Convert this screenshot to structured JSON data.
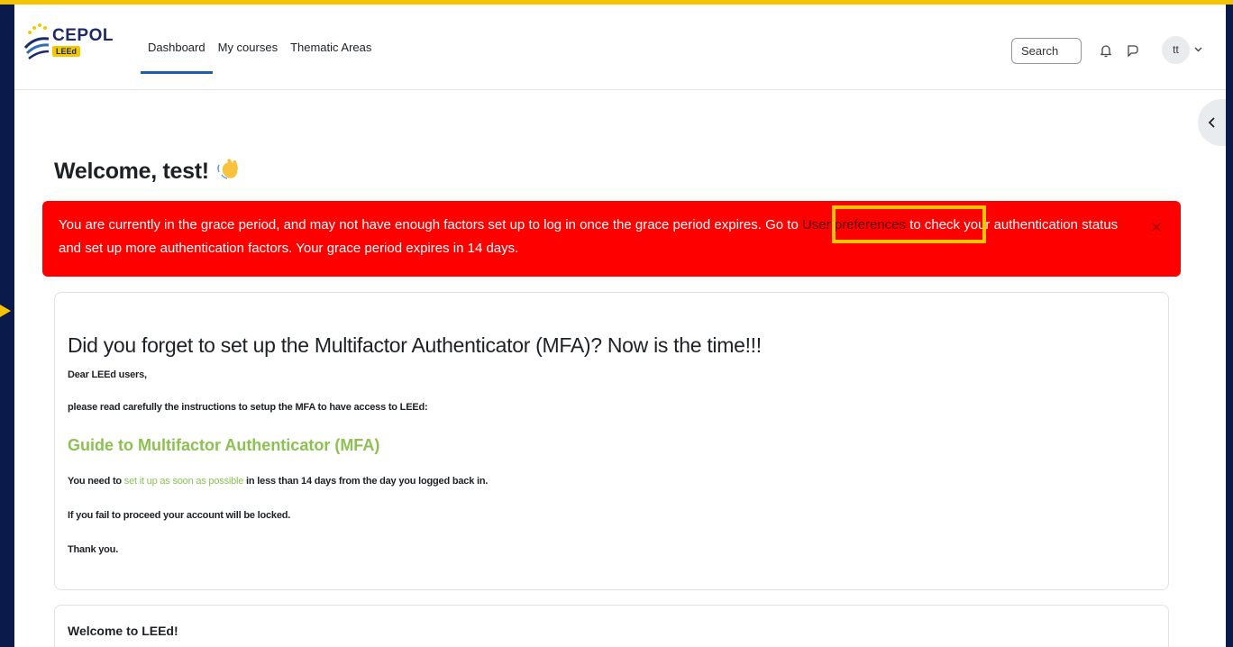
{
  "nav": {
    "logo_text": "CEPOL",
    "logo_badge": "LEEd",
    "links": [
      "Dashboard",
      "My courses",
      "Thematic Areas"
    ],
    "search_label": "Search",
    "avatar_initials": "tt"
  },
  "main": {
    "welcome": "Welcome, test!",
    "alert": {
      "text_before": "You are currently in the grace period, and may not have enough factors set up to log in once the grace period expires. Go to ",
      "link": "User preferences",
      "text_after": " to check your authentication status and set up more authentication factors. Your grace period expires in 14 days."
    },
    "card": {
      "title": "Did you forget to set up the Multifactor Authenticator (MFA)? Now is the time!!!",
      "greeting": "Dear LEEd users,",
      "instructions": "please read carefully the instructions to setup the MFA to have access to LEEd:",
      "guide_link": "Guide to Multifactor Authenticator (MFA)",
      "deadline_before": "You need to ",
      "deadline_link": "set it up as soon as possible",
      "deadline_after": " in less than 14 days from the day you logged back in.",
      "warning": "If you fail to proceed your account will be locked.",
      "thanks": "Thank you."
    },
    "card2": {
      "title": "Welcome to LEEd!"
    }
  },
  "colors": {
    "frame": "#0a1a4a",
    "highlight": "#f5c400",
    "alert": "#ff0000",
    "link_green": "#8cc152",
    "nav_active": "#1f5fa8"
  }
}
